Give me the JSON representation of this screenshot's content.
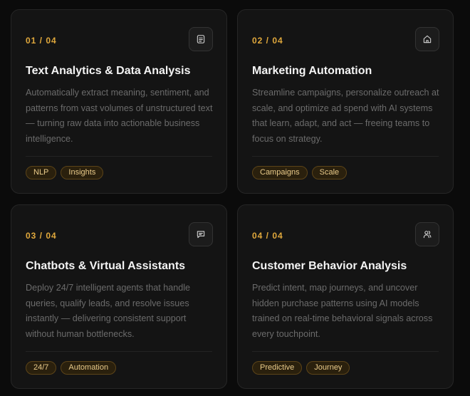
{
  "cards": [
    {
      "step": "01 / 04",
      "icon": "document-icon",
      "title": "Text Analytics & Data Analysis",
      "description": "Automatically extract meaning, sentiment, and patterns from vast volumes of unstructured text — turning raw data into actionable business intelligence.",
      "tags": [
        "NLP",
        "Insights"
      ]
    },
    {
      "step": "02 / 04",
      "icon": "home-icon",
      "title": "Marketing Automation",
      "description": "Streamline campaigns, personalize outreach at scale, and optimize ad spend with AI systems that learn, adapt, and act — freeing teams to focus on strategy.",
      "tags": [
        "Campaigns",
        "Scale"
      ]
    },
    {
      "step": "03 / 04",
      "icon": "chat-icon",
      "title": "Chatbots & Virtual Assistants",
      "description": "Deploy 24/7 intelligent agents that handle queries, qualify leads, and resolve issues instantly — delivering consistent support without human bottlenecks.",
      "tags": [
        "24/7",
        "Automation"
      ]
    },
    {
      "step": "04 / 04",
      "icon": "users-icon",
      "title": "Customer Behavior Analysis",
      "description": "Predict intent, map journeys, and uncover hidden purchase patterns using AI models trained on real-time behavioral signals across every touchpoint.",
      "tags": [
        "Predictive",
        "Journey"
      ]
    }
  ],
  "colors": {
    "accent": "#e0a83c",
    "card_bg": "#141414",
    "page_bg": "#0b0b0b",
    "title": "#f4f4f4",
    "body_text": "#6b6b6b"
  }
}
